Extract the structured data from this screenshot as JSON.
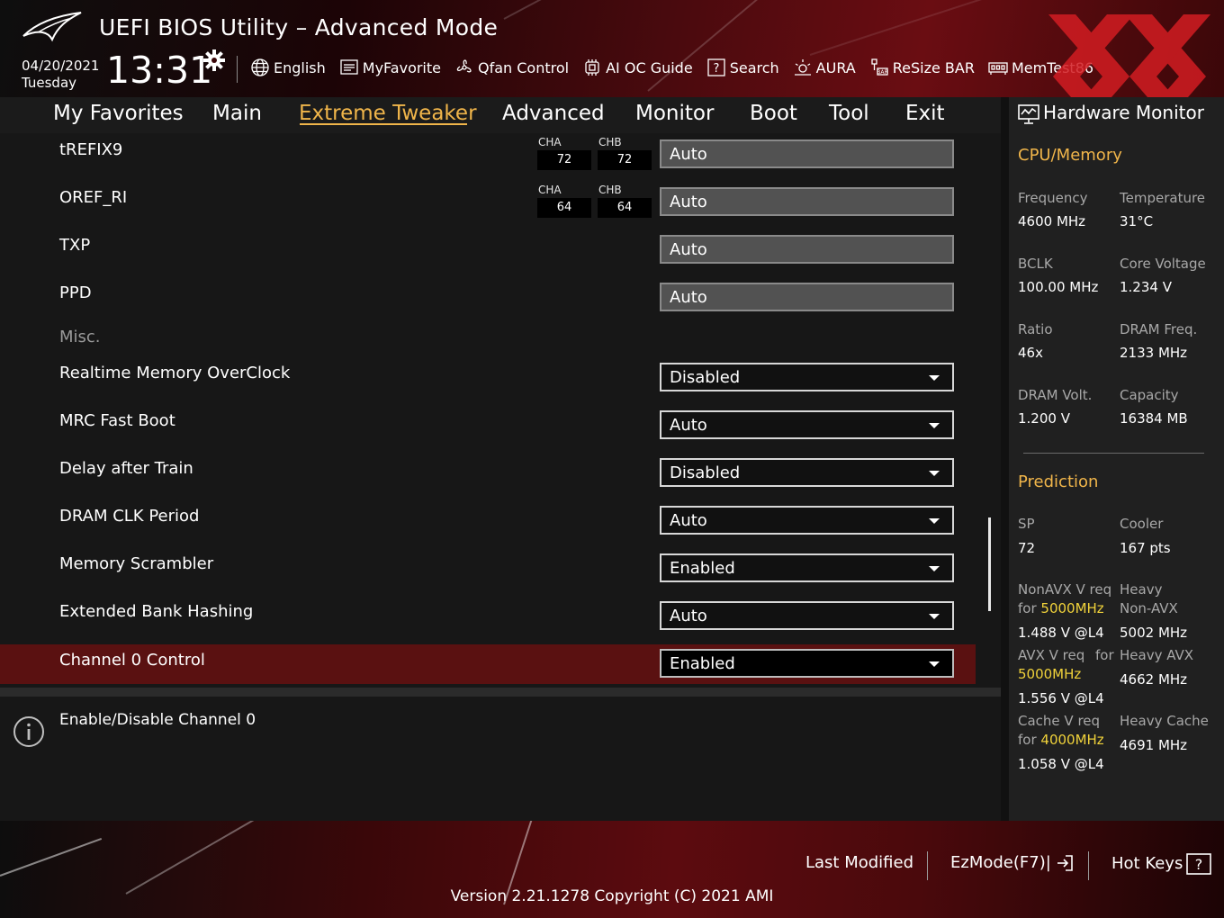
{
  "header": {
    "title": "UEFI BIOS Utility – Advanced Mode",
    "date": "04/20/2021",
    "day": "Tuesday",
    "time": "13:31"
  },
  "toolbar": [
    {
      "label": "English",
      "icon": "globe-icon"
    },
    {
      "label": "MyFavorite",
      "icon": "favorite-icon"
    },
    {
      "label": "Qfan Control",
      "icon": "fan-icon"
    },
    {
      "label": "AI OC Guide",
      "icon": "oc-guide-icon"
    },
    {
      "label": "Search",
      "icon": "search-icon"
    },
    {
      "label": "AURA",
      "icon": "aura-icon"
    },
    {
      "label": "ReSize BAR",
      "icon": "resize-bar-icon"
    },
    {
      "label": "MemTest86",
      "icon": "memtest-icon"
    }
  ],
  "nav": {
    "tabs": [
      "My Favorites",
      "Main",
      "Extreme Tweaker",
      "Advanced",
      "Monitor",
      "Boot",
      "Tool",
      "Exit"
    ],
    "active": "Extreme Tweaker"
  },
  "settings": [
    {
      "label": "tREFIX9",
      "value": "Auto",
      "cha": "72",
      "chb": "72"
    },
    {
      "label": "OREF_RI",
      "value": "Auto",
      "cha": "64",
      "chb": "64"
    },
    {
      "label": "TXP",
      "value": "Auto"
    },
    {
      "label": "PPD",
      "value": "Auto"
    },
    {
      "label": "Misc."
    },
    {
      "label": "Realtime Memory OverClock",
      "value": "Disabled"
    },
    {
      "label": "MRC Fast Boot",
      "value": "Auto"
    },
    {
      "label": "Delay after Train",
      "value": "Disabled"
    },
    {
      "label": "DRAM CLK Period",
      "value": "Auto"
    },
    {
      "label": "Memory Scrambler",
      "value": "Enabled"
    },
    {
      "label": "Extended Bank Hashing",
      "value": "Auto"
    },
    {
      "label": "Channel 0 Control",
      "value": "Enabled"
    }
  ],
  "channel_labels": {
    "a": "CHA",
    "b": "CHB"
  },
  "help": {
    "text": "Enable/Disable Channel 0"
  },
  "hw_monitor": {
    "title": "Hardware Monitor",
    "cpu_memory": {
      "heading": "CPU/Memory",
      "frequency_label": "Frequency",
      "frequency": "4600 MHz",
      "temperature_label": "Temperature",
      "temperature": "31°C",
      "bclk_label": "BCLK",
      "bclk": "100.00 MHz",
      "core_voltage_label": "Core Voltage",
      "core_voltage": "1.234 V",
      "ratio_label": "Ratio",
      "ratio": "46x",
      "dram_freq_label": "DRAM Freq.",
      "dram_freq": "2133 MHz",
      "dram_volt_label": "DRAM Volt.",
      "dram_volt": "1.200 V",
      "capacity_label": "Capacity",
      "capacity": "16384 MB"
    },
    "prediction": {
      "heading": "Prediction",
      "sp_label": "SP",
      "sp": "72",
      "cooler_label": "Cooler",
      "cooler": "167 pts",
      "nonavx_label": "NonAVX V req",
      "nonavx_for": "for",
      "nonavx_freq": "5000MHz",
      "nonavx_value": "1.488 V @L4",
      "heavy_nonavx_label_1": "Heavy",
      "heavy_nonavx_label_2": "Non-AVX",
      "heavy_nonavx_value": "5002 MHz",
      "avx_label": "AVX V req",
      "avx_for": "for",
      "avx_freq": "5000MHz",
      "avx_value": "1.556 V @L4",
      "heavy_avx_label": "Heavy AVX",
      "heavy_avx_value": "4662 MHz",
      "cache_label": "Cache V req",
      "cache_for": "for",
      "cache_freq": "4000MHz",
      "cache_value": "1.058 V @L4",
      "heavy_cache_label": "Heavy Cache",
      "heavy_cache_value": "4691 MHz"
    }
  },
  "footer": {
    "last_modified": "Last Modified",
    "ezmode": "EzMode(F7)|",
    "hot_keys": "Hot Keys",
    "version": "Version 2.21.1278 Copyright (C) 2021 AMI"
  },
  "colors": {
    "accent": "#f0b54a",
    "selected_row": "#5a1111",
    "highlight_freq": "#f0d23a"
  }
}
